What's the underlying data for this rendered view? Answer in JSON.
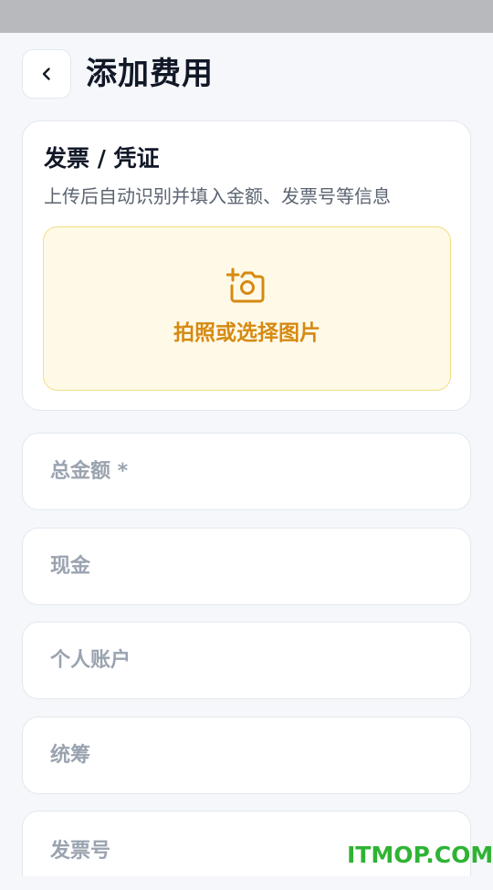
{
  "header": {
    "title": "添加费用"
  },
  "invoice_card": {
    "title": "发票 / 凭证",
    "subtitle": "上传后自动识别并填入金额、发票号等信息",
    "upload_label": "拍照或选择图片"
  },
  "fields": {
    "total_amount_placeholder": "总金额 *",
    "cash_placeholder": "现金",
    "personal_account_placeholder": "个人账户",
    "pooled_fund_placeholder": "统筹",
    "invoice_number_placeholder": "发票号"
  },
  "watermark": {
    "text": "ITMOP.COM"
  },
  "colors": {
    "accent": "#d68a12",
    "upload_bg": "#fffae8",
    "upload_border": "#f3dd82",
    "watermark": "#2fb334"
  },
  "icons": {
    "back": "chevron-left-icon",
    "upload": "camera-plus-icon"
  }
}
